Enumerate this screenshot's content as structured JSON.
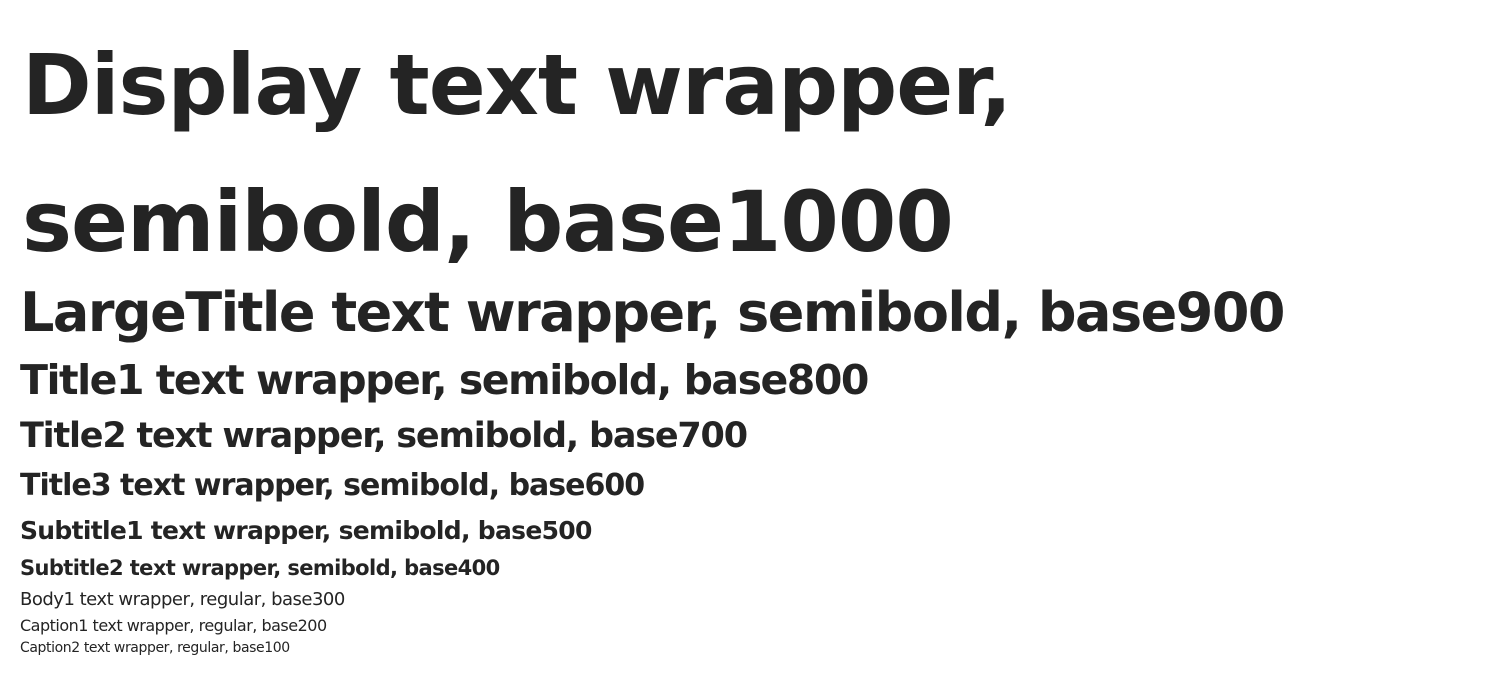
{
  "typography": {
    "display": "Display text wrapper, semibold, base1000",
    "large_title": "LargeTitle text wrapper, semibold, base900",
    "title1": "Title1 text wrapper, semibold, base800",
    "title2": "Title2 text wrapper, semibold, base700",
    "title3": "Title3 text wrapper, semibold, base600",
    "subtitle1": "Subtitle1 text wrapper, semibold, base500",
    "subtitle2": "Subtitle2 text wrapper, semibold, base400",
    "body1": "Body1 text wrapper, regular, base300",
    "caption1": "Caption1 text wrapper, regular, base200",
    "caption2": "Caption2 text wrapper, regular, base100"
  },
  "colors": {
    "text": "#242424",
    "background": "#ffffff"
  }
}
